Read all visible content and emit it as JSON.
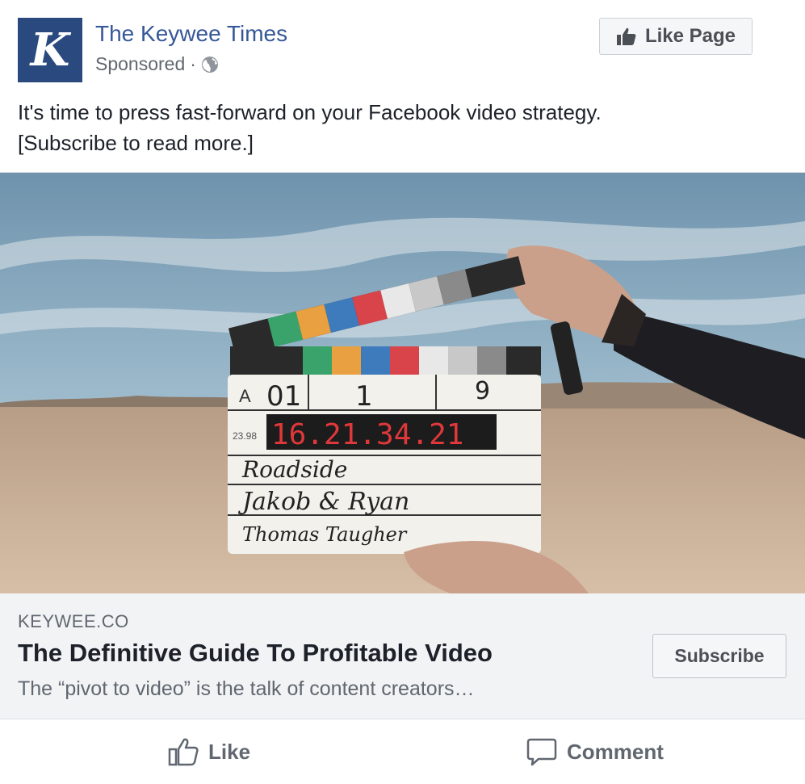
{
  "post": {
    "page_name": "The Keywee Times",
    "avatar_letter": "K",
    "sponsored": "Sponsored",
    "separator": "·",
    "like_page_label": "Like Page",
    "text_line1": "It's time to press fast-forward on your Facebook video strategy.",
    "text_line2": "[Subscribe to read more.]"
  },
  "media": {
    "clapper": {
      "roll": "01",
      "scene": "1",
      "take": "9",
      "fps": "23.98",
      "timecode": "16.21.34.21",
      "production": "Roadside",
      "director": "Jakob & Ryan",
      "camera": "Thomas Taugher"
    }
  },
  "link": {
    "domain": "KEYWEE.CO",
    "headline": "The Definitive Guide To Profitable Video",
    "description": "The “pivot to video” is the talk of content creators…",
    "cta_label": "Subscribe"
  },
  "actions": {
    "like_label": "Like",
    "comment_label": "Comment"
  },
  "colors": {
    "page_link": "#365899",
    "avatar_bg": "#2a4a7f",
    "link_box_bg": "#f2f3f5"
  }
}
